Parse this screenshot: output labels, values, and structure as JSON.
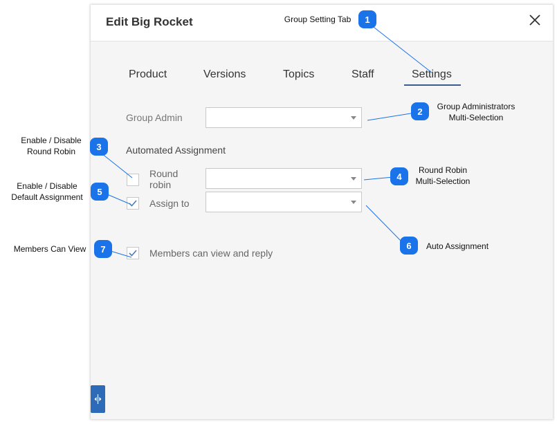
{
  "dialog": {
    "title": "Edit Big Rocket",
    "tabs": [
      {
        "label": "Product"
      },
      {
        "label": "Versions"
      },
      {
        "label": "Topics"
      },
      {
        "label": "Staff"
      },
      {
        "label": "Settings",
        "active": true
      }
    ],
    "group_admin_label": "Group Admin",
    "automated_assignment_label": "Automated Assignment",
    "round_robin_label_line1": "Round",
    "round_robin_label_line2": "robin",
    "assign_to_label": "Assign to",
    "members_can_view_label": "Members can view and reply",
    "round_robin_checked": false,
    "assign_to_checked": true,
    "members_can_view_checked": true
  },
  "callouts": [
    {
      "number": "1",
      "text": "Group Setting Tab"
    },
    {
      "number": "2",
      "text_line1": "Group Administrators",
      "text_line2": "Multi-Selection"
    },
    {
      "number": "3",
      "text_line1": "Enable / Disable",
      "text_line2": "Round Robin"
    },
    {
      "number": "4",
      "text_line1": "Round Robin",
      "text_line2": "Multi-Selection"
    },
    {
      "number": "5",
      "text_line1": "Enable / Disable",
      "text_line2": "Default Assignment"
    },
    {
      "number": "6",
      "text": "Auto Assignment"
    },
    {
      "number": "7",
      "text": "Members Can View"
    }
  ],
  "colors": {
    "callout_blue": "#1a73e8",
    "tab_underline": "#3b5b8c",
    "check": "#4a7bb5"
  }
}
